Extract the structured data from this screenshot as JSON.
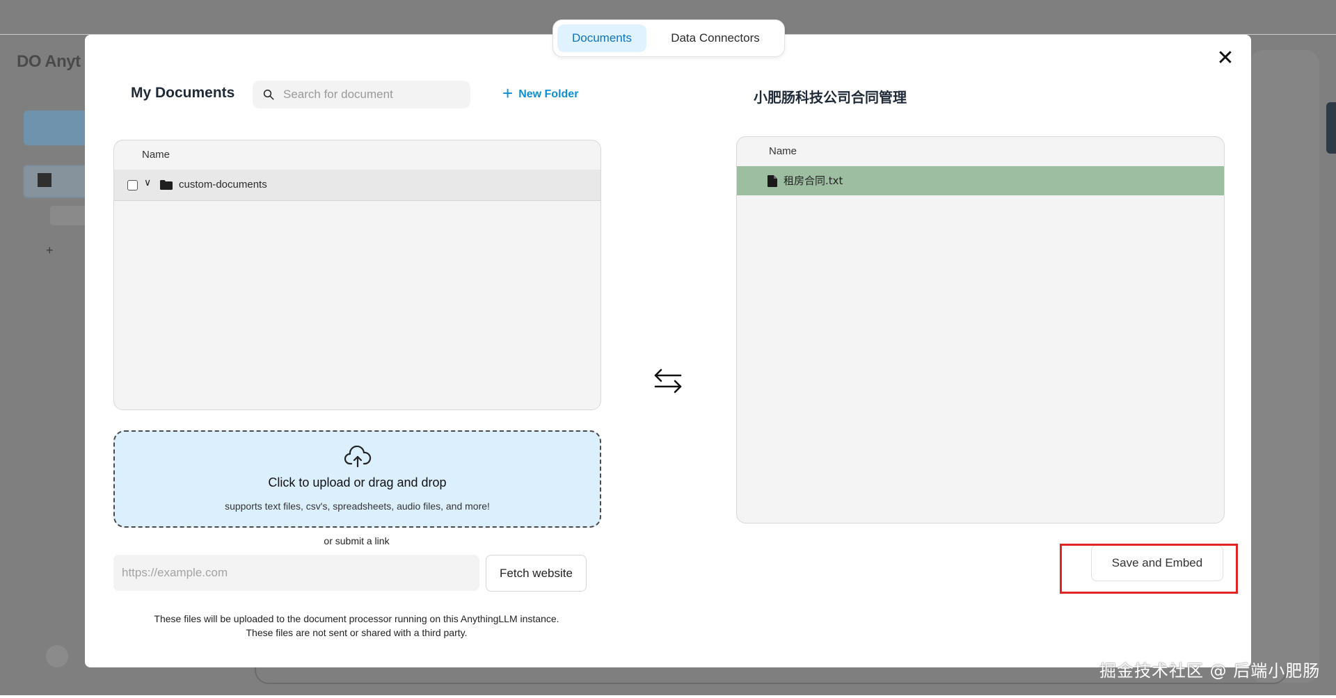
{
  "tabs": [
    {
      "label": "Documents",
      "active": true
    },
    {
      "label": "Data Connectors",
      "active": false
    }
  ],
  "left_panel": {
    "title": "My Documents",
    "search": {
      "placeholder": "Search for document"
    },
    "new_folder_label": "New Folder",
    "table": {
      "header": "Name",
      "rows": [
        {
          "name": "custom-documents",
          "type": "folder",
          "expanded": true,
          "checked": false
        }
      ]
    },
    "upload": {
      "title": "Click to upload or drag and drop",
      "subtitle": "supports text files, csv's, spreadsheets, audio files, and more!"
    },
    "submit_link_label": "or submit a link",
    "url_input": {
      "placeholder": "https://example.com"
    },
    "fetch_button": "Fetch website",
    "note_line1": "These files will be uploaded to the document processor running on this AnythingLLM instance.",
    "note_line2": "These files are not sent or shared with a third party."
  },
  "right_panel": {
    "title": "小肥肠科技公司合同管理",
    "table": {
      "header": "Name",
      "rows": [
        {
          "name": "租房合同.txt",
          "type": "file",
          "selected": true
        }
      ]
    },
    "save_button": "Save and Embed"
  },
  "watermark": "掘金技术社区 @ 后端小肥肠",
  "colors": {
    "accent": "#0a8fd6",
    "selected_row": "#9ebea2",
    "upload_bg": "#dceffd",
    "highlight_border": "#e02424"
  },
  "icons": [
    "search-icon",
    "plus-icon",
    "folder-icon",
    "chevron-down-icon",
    "cloud-upload-icon",
    "swap-arrows-icon",
    "file-icon",
    "close-icon"
  ]
}
